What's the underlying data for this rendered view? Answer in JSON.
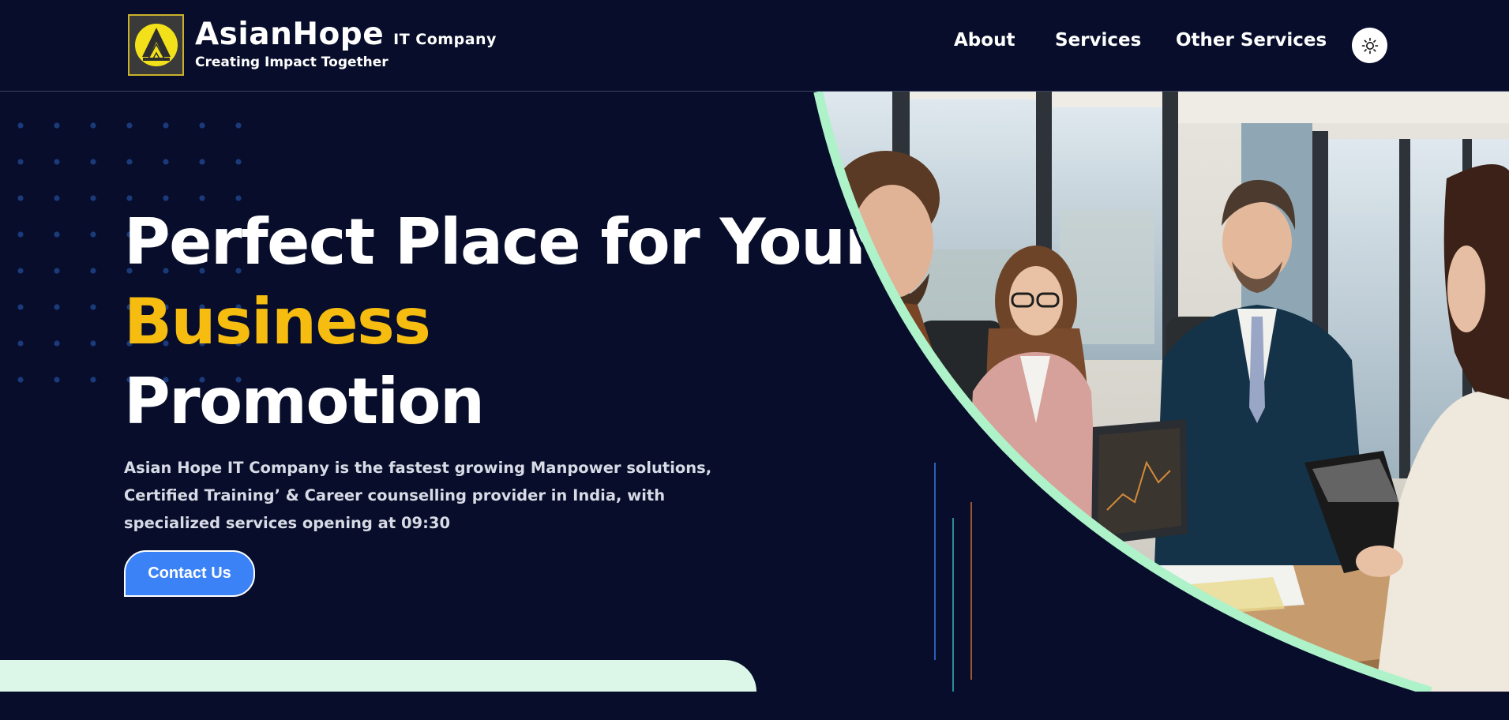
{
  "brand": {
    "name": "AsianHope",
    "subtitle": "IT Company",
    "tagline": "Creating Impact Together",
    "logo_color": "#f2e11a"
  },
  "nav": {
    "items": [
      {
        "label": "About"
      },
      {
        "label": "Services"
      },
      {
        "label": "Other Services"
      }
    ],
    "theme_toggle_icon": "sun-icon"
  },
  "hero": {
    "headline_line1": "Perfect Place for Your",
    "headline_accent": "Business",
    "headline_line3": "Promotion",
    "description": "Asian Hope IT Company is the fastest growing Manpower solutions, Certified Training’ & Career counselling provider in India, with specialized services opening at 09:30",
    "cta_label": "Contact Us",
    "image_icon": "business-meeting-photo"
  },
  "colors": {
    "background": "#070d2a",
    "accent_yellow": "#f6bd10",
    "cta_blue": "#3b82f6",
    "mint": "#dcf7e8",
    "mint_border": "#aef2c9"
  }
}
